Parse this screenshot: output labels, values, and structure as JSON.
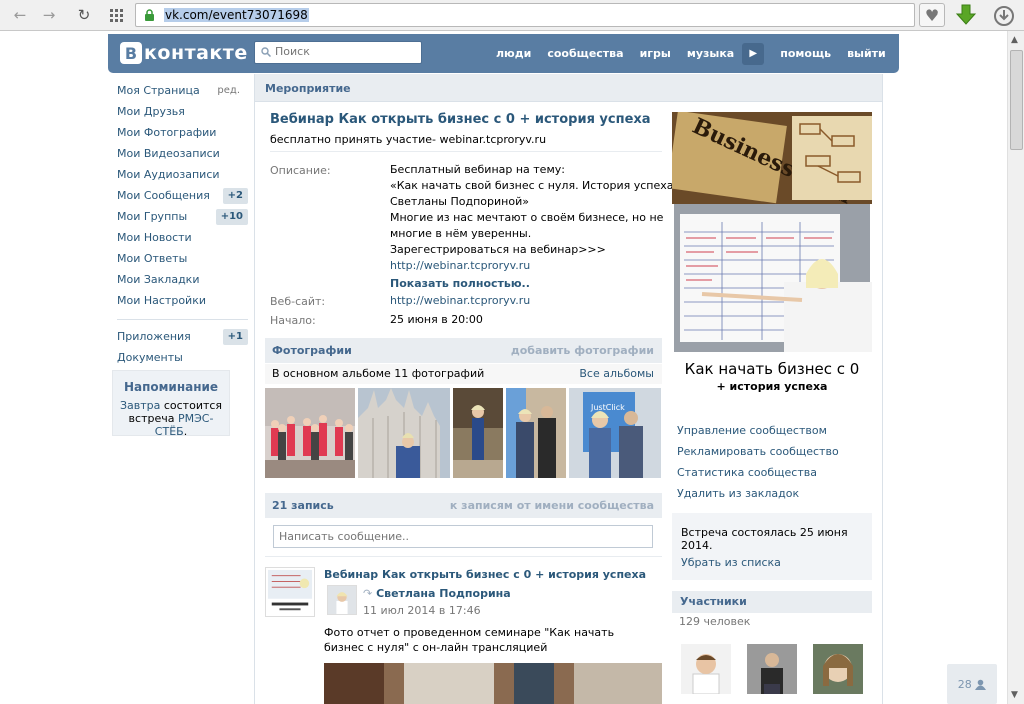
{
  "browser": {
    "url": "vk.com/event73071698"
  },
  "header": {
    "logo_letter": "В",
    "logo_text": "контакте",
    "search_placeholder": "Поиск",
    "nav": [
      "люди",
      "сообщества",
      "игры",
      "музыка",
      "помощь",
      "выйти"
    ],
    "color": "#597da3"
  },
  "left_menu": {
    "items": [
      {
        "label": "Моя Страница",
        "extra": "ред."
      },
      {
        "label": "Мои Друзья"
      },
      {
        "label": "Мои Фотографии"
      },
      {
        "label": "Мои Видеозаписи"
      },
      {
        "label": "Мои Аудиозаписи"
      },
      {
        "label": "Мои Сообщения",
        "count": "+2"
      },
      {
        "label": "Мои Группы",
        "count": "+10"
      },
      {
        "label": "Мои Новости"
      },
      {
        "label": "Мои Ответы"
      },
      {
        "label": "Мои Закладки"
      },
      {
        "label": "Мои Настройки"
      }
    ],
    "secondary": [
      {
        "label": "Приложения",
        "count": "+1"
      },
      {
        "label": "Документы"
      }
    ]
  },
  "reminder": {
    "title": "Напоминание",
    "when": "Завтра",
    "mid": " состоится встреча ",
    "event": "РМЭС-СТЁБ",
    "end": "."
  },
  "breadcrumb": "Мероприятие",
  "event": {
    "title": "Вебинар Как открыть бизнес с 0 + история успеха",
    "status": "бесплатно принять участие- webinar.tcproryv.ru",
    "description_label": "Описание:",
    "description_lines": [
      "Бесплатный вебинар на тему:",
      "«Как начать свой бизнес с нуля. История успеха",
      "Светланы Подпориной»",
      "Многие из нас мечтают о своём бизнесе, но не",
      "многие в нём уверенны.",
      "Зарегестрироваться на вебинар>>>"
    ],
    "description_link": "http://webinar.tcproryv.ru",
    "show_more": "Показать полностью..",
    "website_label": "Веб-сайт:",
    "website": "http://webinar.tcproryv.ru",
    "start_label": "Начало:",
    "start": "25 июня в 20:00"
  },
  "photos": {
    "title": "Фотографии",
    "add": "добавить фотографии",
    "album_info": "В основном альбоме 11 фотографий",
    "all_albums": "Все альбомы"
  },
  "wall": {
    "count": "21 запись",
    "as_community": "к записям от имени сообщества",
    "placeholder": "Написать сообщение..",
    "post": {
      "title": "Вебинар Как открыть бизнес с 0 + история успеха",
      "author": "Светлана Подпорина",
      "date": "11 июл 2014 в 17:46",
      "text": "Фото отчет о проведенном семинаре \"Как начать бизнес с нуля\" с он-лайн трансляцией"
    }
  },
  "cover": {
    "caption_main": "Как начать бизнес с 0",
    "caption_sub": "+ история успеха",
    "book_text": "Business Plan"
  },
  "right_links": [
    "Управление сообществом",
    "Рекламировать сообщество",
    "Статистика сообщества",
    "Удалить из закладок"
  ],
  "status_box": {
    "text": "Встреча состоялась 25 июня 2014.",
    "remove": "Убрать из списка"
  },
  "members": {
    "title": "Участники",
    "count": "129 человек"
  },
  "floating": {
    "count": "28"
  }
}
